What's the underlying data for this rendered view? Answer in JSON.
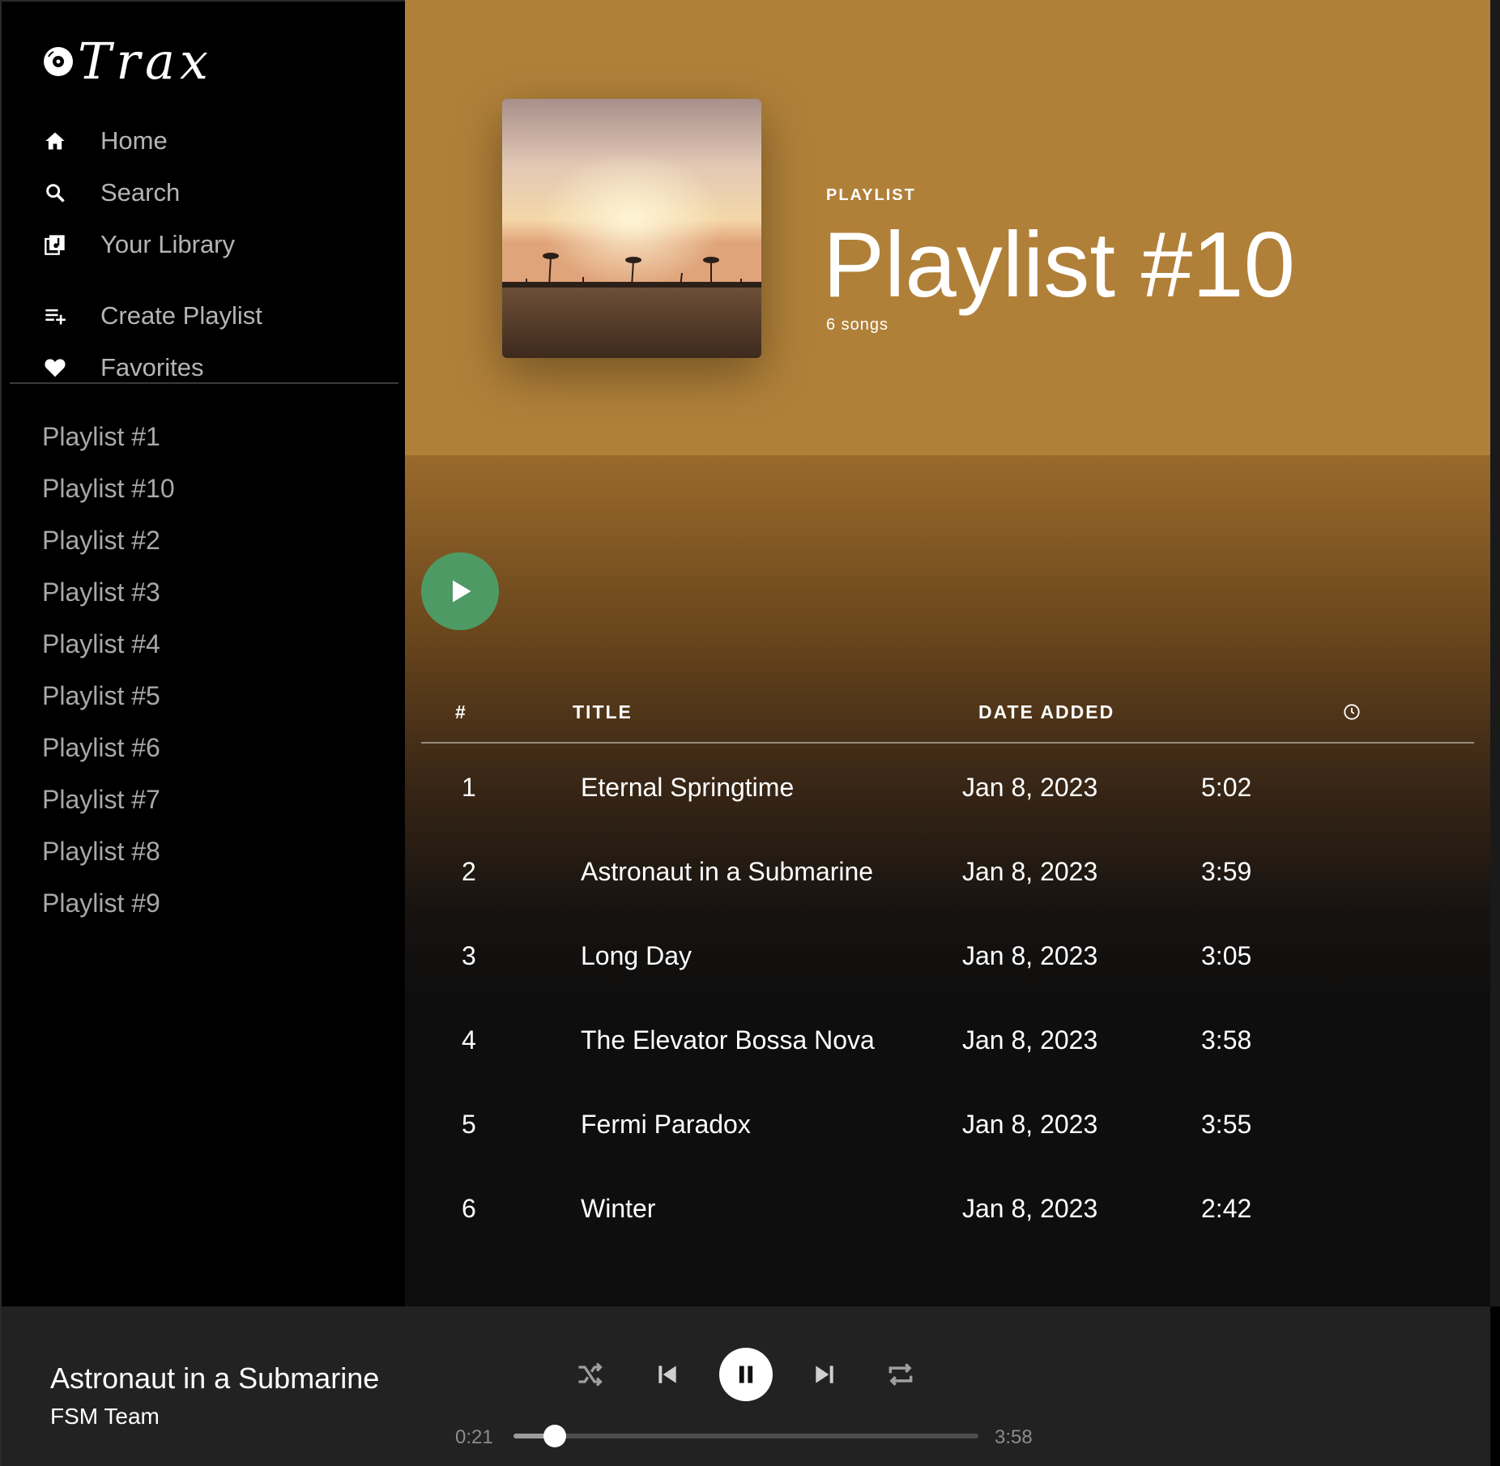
{
  "app": {
    "logo_text": "Trax"
  },
  "nav": {
    "primary": [
      {
        "label": "Home",
        "icon": "home-icon"
      },
      {
        "label": "Search",
        "icon": "search-icon"
      },
      {
        "label": "Your Library",
        "icon": "library-icon"
      }
    ],
    "secondary": [
      {
        "label": "Create Playlist",
        "icon": "playlist-add-icon"
      },
      {
        "label": "Favorites",
        "icon": "heart-icon"
      }
    ]
  },
  "sidebar_playlists": [
    "Playlist #1",
    "Playlist #10",
    "Playlist #2",
    "Playlist #3",
    "Playlist #4",
    "Playlist #5",
    "Playlist #6",
    "Playlist #7",
    "Playlist #8",
    "Playlist #9"
  ],
  "header": {
    "type_label": "PLAYLIST",
    "title": "Playlist #10",
    "song_count": "6 songs",
    "header_color": "#b08039"
  },
  "table": {
    "columns": {
      "num": "#",
      "title": "TITLE",
      "date": "DATE ADDED",
      "duration_icon": "clock-icon"
    },
    "rows": [
      {
        "num": "1",
        "title": "Eternal Springtime",
        "date": "Jan 8, 2023",
        "duration": "5:02"
      },
      {
        "num": "2",
        "title": "Astronaut in a Submarine",
        "date": "Jan 8, 2023",
        "duration": "3:59"
      },
      {
        "num": "3",
        "title": "Long Day",
        "date": "Jan 8, 2023",
        "duration": "3:05"
      },
      {
        "num": "4",
        "title": "The Elevator Bossa Nova",
        "date": "Jan 8, 2023",
        "duration": "3:58"
      },
      {
        "num": "5",
        "title": "Fermi Paradox",
        "date": "Jan 8, 2023",
        "duration": "3:55"
      },
      {
        "num": "6",
        "title": "Winter",
        "date": "Jan 8, 2023",
        "duration": "2:42"
      }
    ]
  },
  "player": {
    "track_title": "Astronaut in a Submarine",
    "artist": "FSM Team",
    "elapsed": "0:21",
    "total": "3:58",
    "progress": 0.088,
    "state": "playing",
    "accent_play_color": "#4e9a64"
  }
}
